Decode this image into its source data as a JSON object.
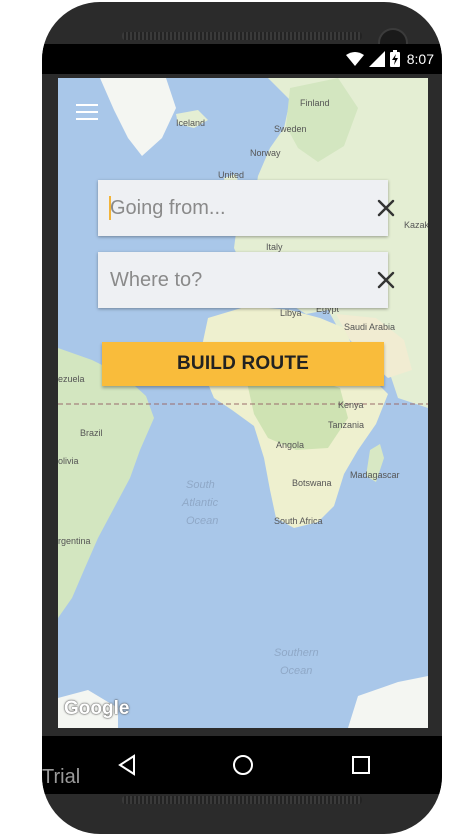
{
  "status_bar": {
    "time": "8:07",
    "icons": [
      "wifi-icon",
      "signal-icon",
      "battery-charging-icon"
    ]
  },
  "map": {
    "attribution": "Google",
    "labels": {
      "finland": "Finland",
      "iceland": "Iceland",
      "sweden": "Sweden",
      "norway": "Norway",
      "united": "United",
      "kazakh": "Kazak",
      "italy": "Italy",
      "libya": "Libya",
      "egypt": "Egypt",
      "saudi": "Saudi Arabia",
      "venezuela": "ezuela",
      "kenya": "Kenya",
      "brazil": "Brazil",
      "tanzania": "Tanzania",
      "bolivia": "olivia",
      "angola": "Angola",
      "madagascar": "Madagascar",
      "botswana": "Botswana",
      "south_africa": "South Africa",
      "argentina": "rgentina",
      "south_atlantic_1": "South",
      "south_atlantic_2": "Atlantic",
      "south_atlantic_3": "Ocean",
      "southern_1": "Southern",
      "southern_2": "Ocean"
    }
  },
  "search": {
    "from_placeholder": "Going from...",
    "to_placeholder": "Where to?",
    "from_value": "",
    "to_value": ""
  },
  "actions": {
    "build_route_label": "BUILD ROUTE"
  },
  "watermark": "Trial",
  "colors": {
    "ocean": "#a9c7e9",
    "land": "#e4eed3",
    "button": "#f9bc3b",
    "field_bg": "#eef0f3"
  }
}
